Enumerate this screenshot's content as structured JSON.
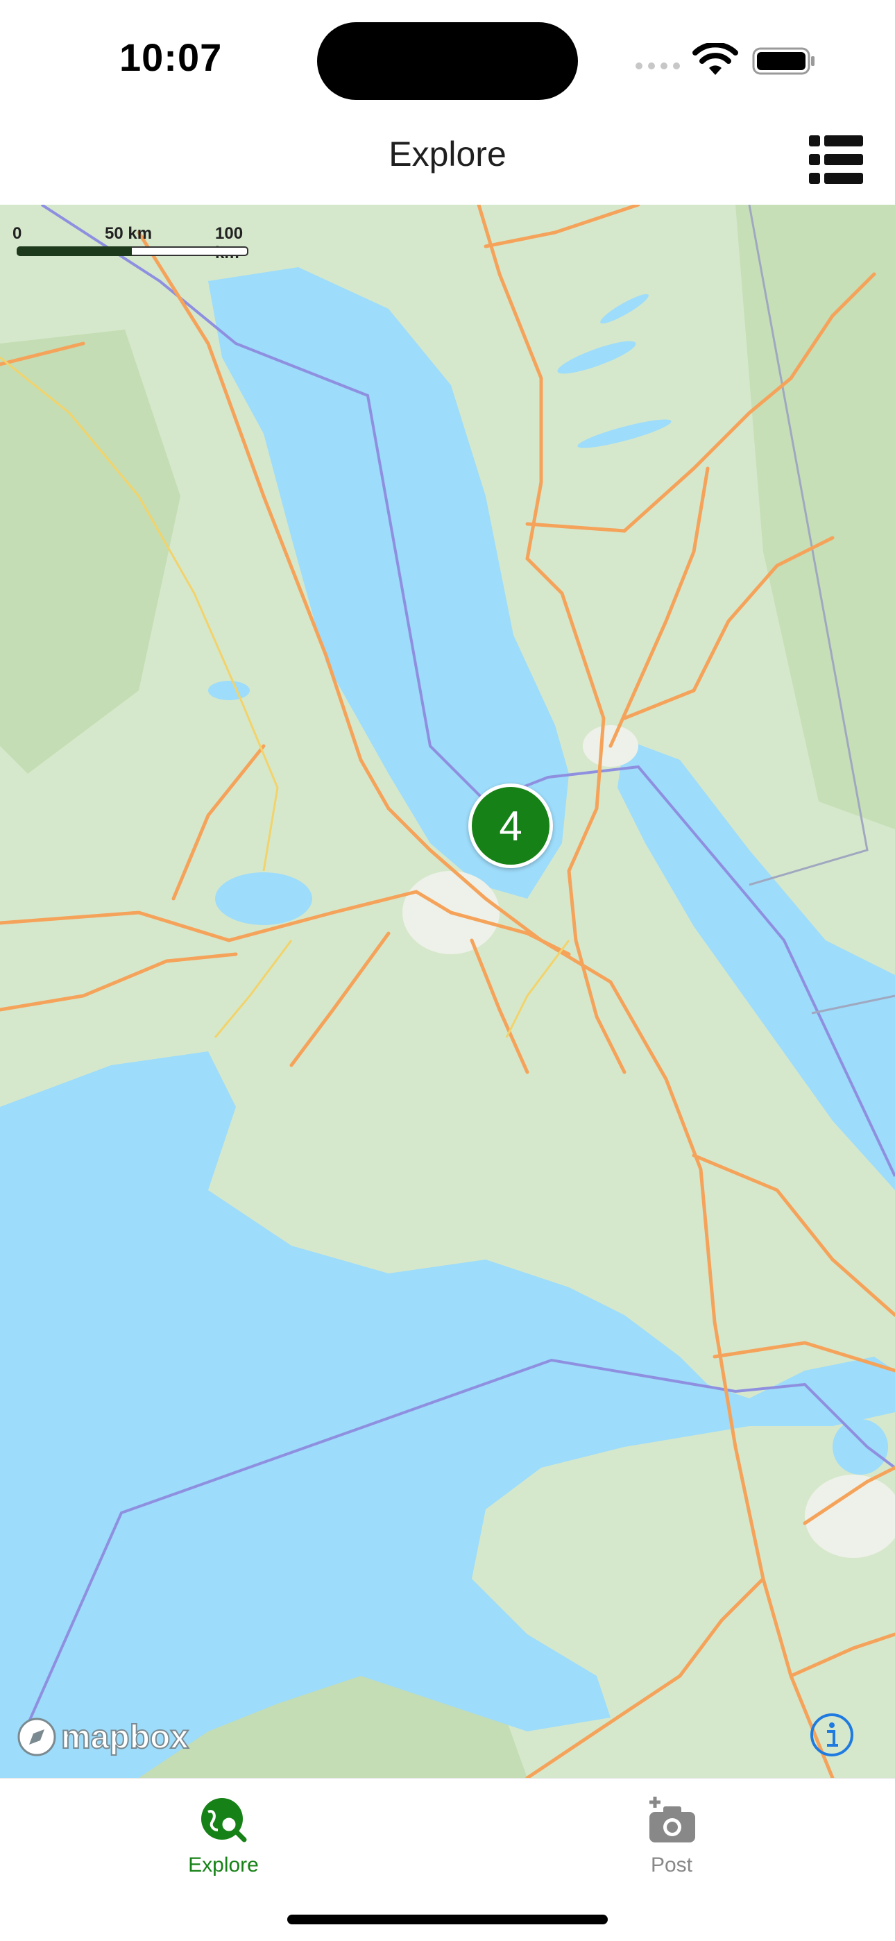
{
  "status_bar": {
    "time": "10:07"
  },
  "nav": {
    "title": "Explore",
    "list_icon": "list-icon"
  },
  "map": {
    "scale": {
      "zero": "0",
      "mid": "50 km",
      "max": "100 km"
    },
    "cluster_count": "4",
    "cluster_color": "#168116",
    "attribution": "mapbox",
    "info_icon": "info-icon",
    "water_color": "#9ddcfa",
    "land_color": "#d6e8cc",
    "road_color": "#f5a35a"
  },
  "tabs": [
    {
      "label": "Explore",
      "icon": "globe-search-icon",
      "active": true,
      "color": "#168116"
    },
    {
      "label": "Post",
      "icon": "camera-plus-icon",
      "active": false,
      "color": "#888888"
    }
  ]
}
